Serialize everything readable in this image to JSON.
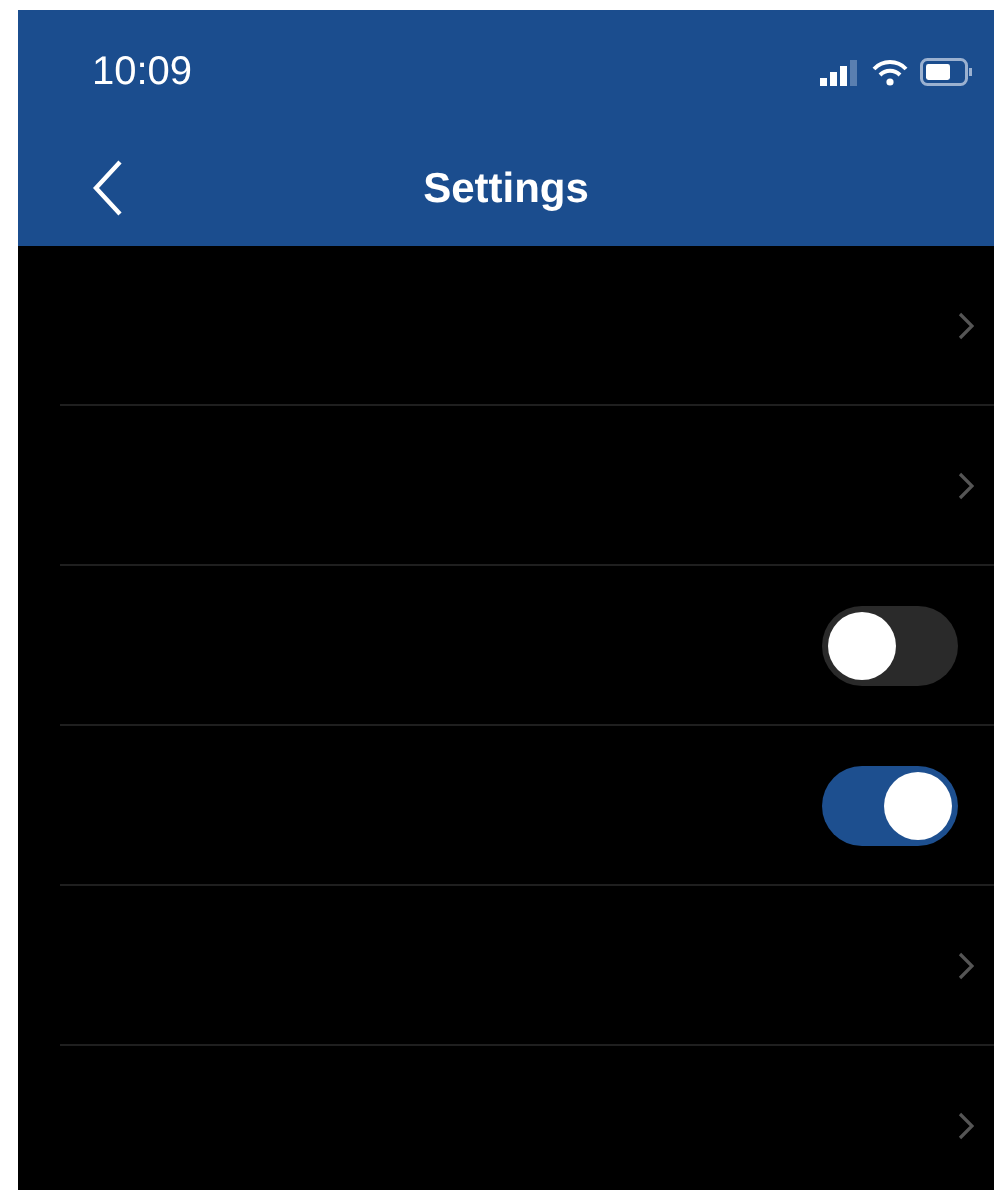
{
  "status_bar": {
    "time": "10:09"
  },
  "nav_bar": {
    "title": "Settings"
  },
  "rows": [
    {
      "kind": "link"
    },
    {
      "kind": "link"
    },
    {
      "kind": "toggle",
      "on": false
    },
    {
      "kind": "toggle",
      "on": true
    },
    {
      "kind": "link"
    },
    {
      "kind": "link"
    }
  ]
}
